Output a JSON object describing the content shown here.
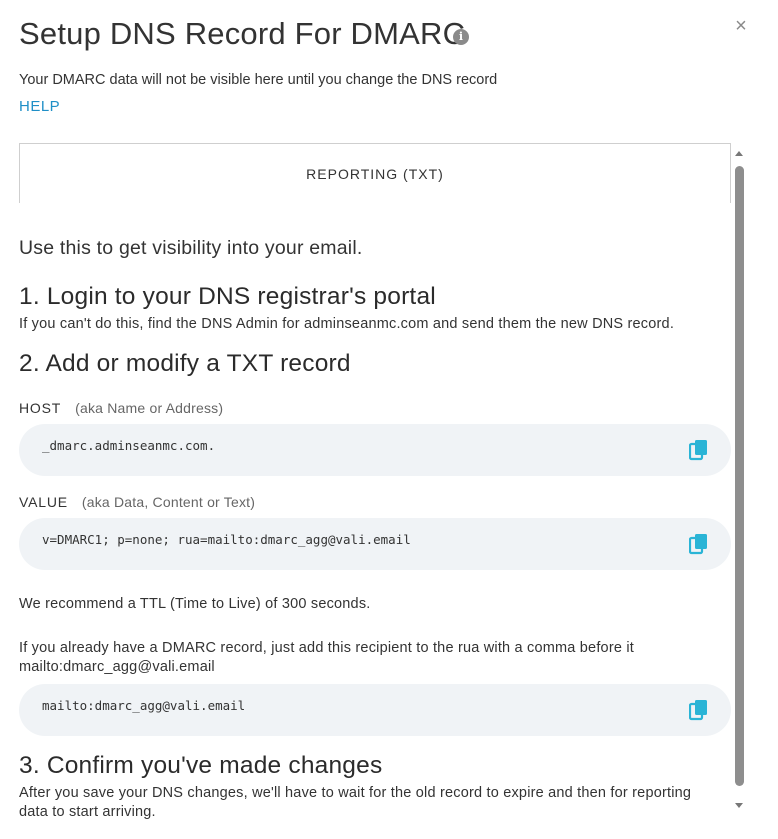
{
  "dialog": {
    "title": "Setup DNS Record For DMARC",
    "info_icon": "info-icon",
    "close_label": "×",
    "subtitle": "Your DMARC data will not be visible here until you change the DNS record",
    "help_label": "HELP"
  },
  "tab": {
    "label": "REPORTING (TXT)"
  },
  "content": {
    "intro": "Use this to get visibility into your email.",
    "step1": {
      "heading": "1. Login to your DNS registrar's portal",
      "text": "If you can't do this, find the DNS Admin for adminseanmc.com and send them the new DNS record."
    },
    "step2": {
      "heading": "2. Add or modify a TXT record",
      "host_label": "HOST",
      "host_hint": "(aka Name or Address)",
      "host_value": "_dmarc.adminseanmc.com.",
      "value_label": "VALUE",
      "value_hint": "(aka Data, Content or Text)",
      "value_value": "v=DMARC1; p=none; rua=mailto:dmarc_agg@vali.email",
      "ttl_text": "We recommend a TTL (Time to Live) of 300 seconds.",
      "existing_text_line1": "If you already have a DMARC record, just add this recipient to the rua with a comma before it",
      "existing_text_line2": "mailto:dmarc_agg@vali.email",
      "recipient_value": "mailto:dmarc_agg@vali.email"
    },
    "step3": {
      "heading": "3. Confirm you've made changes",
      "text_line1": "After you save your DNS changes, we'll have to wait for the old record to expire and then for reporting",
      "text_line2": "data to start arriving."
    }
  },
  "icons": {
    "copy": "copy-icon",
    "close": "close-icon"
  },
  "colors": {
    "link": "#1f8fc7",
    "copy_icon": "#2ab4d6",
    "code_bg": "#f0f3f6"
  }
}
